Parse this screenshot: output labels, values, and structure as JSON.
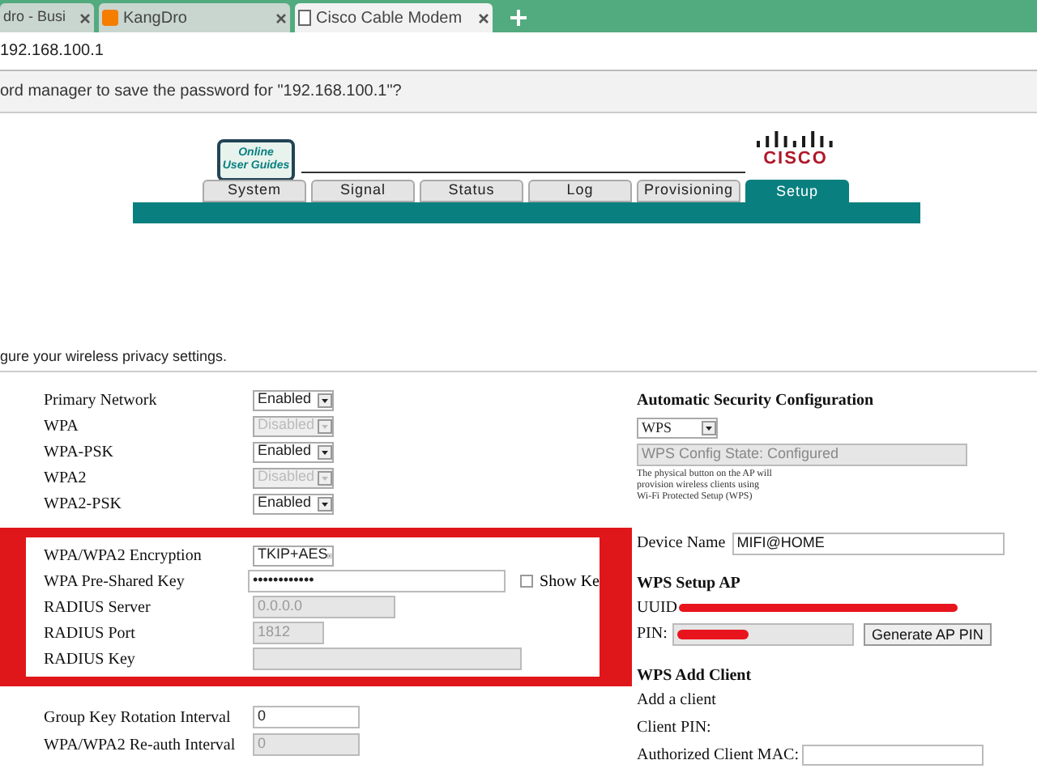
{
  "browser": {
    "tabs": [
      {
        "title": "dro - Busi",
        "selected": false
      },
      {
        "title": "KangDro",
        "selected": false
      },
      {
        "title": "Cisco Cable Modem",
        "selected": true
      }
    ],
    "address": "192.168.100.1",
    "password_prompt": "ord manager to save the password for \"192.168.100.1\"?"
  },
  "header": {
    "guide_logo_lines": [
      "Online",
      "User Guides"
    ],
    "brand": "CISCO",
    "nav_tabs": [
      {
        "label": "System",
        "selected": false
      },
      {
        "label": "Signal",
        "selected": false
      },
      {
        "label": "Status",
        "selected": false
      },
      {
        "label": "Log",
        "selected": false
      },
      {
        "label": "Provisioning",
        "selected": false
      },
      {
        "label": "Setup",
        "selected": true
      }
    ]
  },
  "intro": "gure your wireless privacy settings.",
  "left_groups": [
    {
      "highlighted": false,
      "fields": [
        {
          "label": "Primary Network",
          "kind": "select",
          "value": "Enabled",
          "disabled": false
        },
        {
          "label": "WPA",
          "kind": "select",
          "value": "Disabled",
          "disabled": true
        },
        {
          "label": "WPA-PSK",
          "kind": "select",
          "value": "Enabled",
          "disabled": false
        },
        {
          "label": "WPA2",
          "kind": "select",
          "value": "Disabled",
          "disabled": true
        },
        {
          "label": "WPA2-PSK",
          "kind": "select",
          "value": "Enabled",
          "disabled": false
        }
      ]
    },
    {
      "highlighted": true,
      "fields": [
        {
          "label": "WPA/WPA2 Encryption",
          "kind": "select",
          "value": "TKIP+AES",
          "disabled": false
        },
        {
          "label": "WPA Pre-Shared Key",
          "kind": "password",
          "value": "••••••••••••",
          "disabled": false,
          "checkbox": {
            "label": "Show Ke",
            "checked": false
          }
        },
        {
          "label": "RADIUS Server",
          "kind": "text",
          "value": "0.0.0.0",
          "disabled": true
        },
        {
          "label": "RADIUS Port",
          "kind": "text",
          "value": "1812",
          "disabled": true
        },
        {
          "label": "RADIUS Key",
          "kind": "text",
          "disabled": true
        }
      ]
    },
    {
      "highlighted": false,
      "fields": [
        {
          "label": "Group Key Rotation Interval",
          "kind": "text",
          "value": "0",
          "disabled": false
        },
        {
          "label": "WPA/WPA2 Re-auth Interval",
          "kind": "text",
          "value": "0",
          "disabled": true
        }
      ]
    }
  ],
  "right": {
    "auto_title": "Automatic Security Configuration",
    "auto_select": "WPS",
    "config_state": "WPS Config State: Configured",
    "note": [
      "The physical button on the AP will",
      "provision wireless clients using",
      "Wi-Fi Protected Setup (WPS)"
    ],
    "device_name_label": "Device Name",
    "device_name": "MIFI@HOME",
    "setup_title": "WPS Setup AP",
    "uuid_label": "UUID",
    "pin_label": "PIN:",
    "generate_button": "Generate AP PIN",
    "add_title": "WPS Add Client",
    "add_client_label": "Add a client",
    "client_pin_label": "Client PIN:",
    "mac_label": "Authorized Client MAC:"
  }
}
